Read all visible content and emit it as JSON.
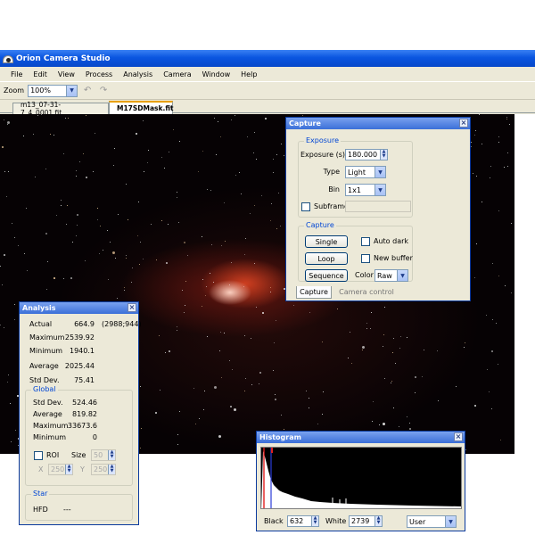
{
  "window": {
    "title": "Orion Camera Studio"
  },
  "menu": [
    "File",
    "Edit",
    "View",
    "Process",
    "Analysis",
    "Camera",
    "Window",
    "Help"
  ],
  "toolbar": {
    "zoom_label": "Zoom",
    "zoom_value": "100%"
  },
  "tabs": [
    {
      "label": "m13_07-31-7_4_0001.fit",
      "active": false
    },
    {
      "label": "M17SDMask.fit",
      "active": true
    }
  ],
  "capture": {
    "title": "Capture",
    "exposure_group": "Exposure",
    "exposure_label": "Exposure (s)",
    "exposure_value": "180.000",
    "type_label": "Type",
    "type_value": "Light",
    "bin_label": "Bin",
    "bin_value": "1x1",
    "subframe_label": "Subframe",
    "capture_group": "Capture",
    "single_button": "Single",
    "loop_button": "Loop",
    "sequence_button": "Sequence",
    "auto_dark_label": "Auto dark",
    "new_buffer_label": "New buffer",
    "color_label": "Color",
    "color_value": "Raw",
    "tab_capture": "Capture",
    "tab_camera_control": "Camera control"
  },
  "analysis": {
    "title": "Analysis",
    "actual_label": "Actual",
    "actual_value": "664.9",
    "actual_coords": "(2988;944)",
    "maximum_label": "Maximum",
    "maximum_value": "2539.92",
    "minimum_label": "Minimum",
    "minimum_value": "1940.1",
    "average_label": "Average",
    "average_value": "2025.44",
    "stddev_label": "Std Dev.",
    "stddev_value": "75.41",
    "global_group": "Global",
    "g_stddev_label": "Std Dev.",
    "g_stddev_value": "524.46",
    "g_average_label": "Average",
    "g_average_value": "819.82",
    "g_maximum_label": "Maximum",
    "g_maximum_value": "33673.6",
    "g_minimum_label": "Minimum",
    "g_minimum_value": "0",
    "roi_label": "ROI",
    "size_label": "Size",
    "size_value": "50",
    "x_label": "X",
    "x_value": "250",
    "y_label": "Y",
    "y_value": "250",
    "star_group": "Star",
    "hfd_label": "HFD",
    "hfd_value": "---"
  },
  "histogram": {
    "title": "Histogram",
    "black_label": "Black",
    "black_value": "632",
    "white_label": "White",
    "white_value": "2739",
    "mode_value": "User"
  },
  "colors": {
    "titlebar": "#0a55e0",
    "panel_bg": "#ece9d8",
    "group_label": "#0046d5",
    "nebula": "#e14623"
  }
}
